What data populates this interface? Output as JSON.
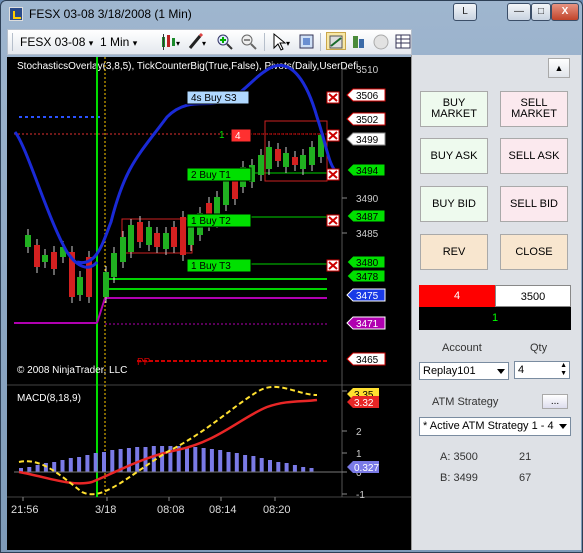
{
  "window": {
    "title": "FESX 03-08  3/18/2008 (1 Min)",
    "buttons": {
      "link": "L",
      "minimize": "—",
      "maximize": "□",
      "close": "X"
    }
  },
  "toolbar": {
    "instrument": "FESX 03-08",
    "interval": "1 Min"
  },
  "chart": {
    "indicators_label": "StochasticsOverlay(3,8,5), TickCounterBig(True,False), Pivots(Daily,UserDefi",
    "copyright": "© 2008 NinjaTrader, LLC",
    "pivot_label": "PP",
    "macd_label": "MACD(8,18,9)",
    "price_axis": [
      "3510",
      "3506",
      "3502",
      "3499",
      "3494",
      "3490",
      "3487",
      "3485",
      "3480",
      "3478",
      "3475",
      "3471",
      "3465"
    ],
    "price_axis_highlight": [
      "3506",
      "3502",
      "3499",
      "3494",
      "3487",
      "3480",
      "3478",
      "3475",
      "3471",
      "3465"
    ],
    "macd_axis": [
      "2",
      "1",
      "0",
      "-1",
      "3"
    ],
    "macd_badges": {
      "red": "3.32",
      "blue": "0.327",
      "yellow": "3.35"
    },
    "time_axis": [
      "21:56",
      "3/18",
      "08:08",
      "08:14",
      "08:20"
    ],
    "orders": [
      {
        "label": "4s  Buy S3"
      },
      {
        "label": "4"
      },
      {
        "label": "2  Buy T1"
      },
      {
        "label": "1  Buy T2"
      },
      {
        "label": "1  Buy T3"
      }
    ],
    "position_qty": "1",
    "colors": {
      "stochastics": "#1a2ad6",
      "macd": "#e82626",
      "signal": "#ffe030",
      "buy_target": "#00d200",
      "pivot": "#b000b0",
      "stop": "#cc0000"
    }
  },
  "side": {
    "buy_market": "BUY MARKET",
    "sell_market": "SELL MARKET",
    "buy_ask": "BUY ASK",
    "sell_ask": "SELL ASK",
    "buy_bid": "BUY BID",
    "sell_bid": "SELL BID",
    "rev": "REV",
    "close": "CLOSE",
    "position_qty": "4",
    "position_price": "3500",
    "pnl": "1",
    "account_label": "Account",
    "account_value": "Replay101",
    "qty_label": "Qty",
    "qty_value": "4",
    "atm_label": "ATM Strategy",
    "atm_dots": "...",
    "atm_value": "* Active ATM Strategy 1 - 4",
    "ask_label": "A: 3500",
    "ask_size": "21",
    "bid_label": "B: 3499",
    "bid_size": "67"
  }
}
